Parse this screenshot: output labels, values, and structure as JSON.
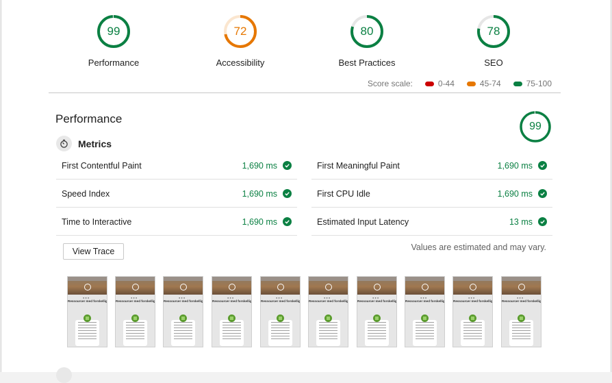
{
  "gauges": [
    {
      "score": "99",
      "label": "Performance",
      "value": 0.99,
      "color": "#0b8043"
    },
    {
      "score": "72",
      "label": "Accessibility",
      "value": 0.72,
      "color": "#e67700"
    },
    {
      "score": "80",
      "label": "Best Practices",
      "value": 0.8,
      "color": "#0b8043"
    },
    {
      "score": "78",
      "label": "SEO",
      "value": 0.78,
      "color": "#0b8043"
    }
  ],
  "scale": {
    "label": "Score scale:",
    "ranges": [
      {
        "text": "0-44",
        "color": "#cc0000"
      },
      {
        "text": "45-74",
        "color": "#e67700"
      },
      {
        "text": "75-100",
        "color": "#0b8043"
      }
    ]
  },
  "performance": {
    "title": "Performance",
    "score": "99",
    "value": 0.99,
    "metrics_title": "Metrics",
    "metrics": [
      {
        "name": "First Contentful Paint",
        "value": "1,690 ms"
      },
      {
        "name": "First Meaningful Paint",
        "value": "1,690 ms"
      },
      {
        "name": "Speed Index",
        "value": "1,690 ms"
      },
      {
        "name": "First CPU Idle",
        "value": "1,690 ms"
      },
      {
        "name": "Time to Interactive",
        "value": "1,690 ms"
      },
      {
        "name": "Estimated Input Latency",
        "value": "13 ms"
      }
    ],
    "estimate_note": "Values are estimated and may vary.",
    "view_trace": "View Trace",
    "filmstrip_heading": "Ressourcer med forskellighed"
  },
  "colors": {
    "pass": "#0b8043",
    "average": "#e67700",
    "fail": "#cc0000"
  }
}
